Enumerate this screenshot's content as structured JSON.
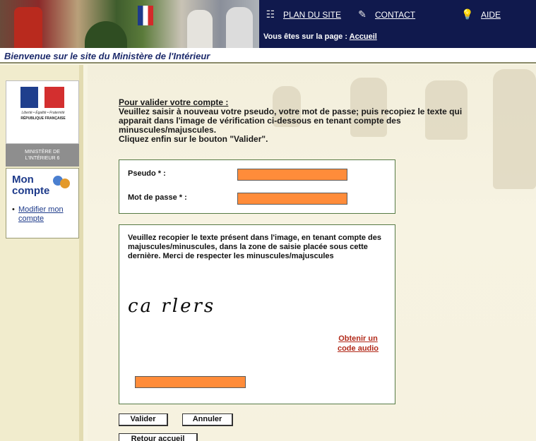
{
  "header": {
    "nav": [
      {
        "label": "PLAN DU SITE",
        "icon": "sitemap-icon"
      },
      {
        "label": "CONTACT",
        "icon": "pencil-icon"
      },
      {
        "label": "AIDE",
        "icon": "lightbulb-icon"
      }
    ],
    "breadcrumb_prefix": "Vous êtes sur la page :",
    "breadcrumb_page": "Accueil",
    "welcome": "Bienvenue sur le site du Ministère de l'Intérieur"
  },
  "sidebar": {
    "ministry_line1": "MINISTÈRE DE",
    "ministry_line2": "L'INTÉRIEUR 6",
    "motto": "Liberté • Égalité • Fraternité",
    "republic": "RÉPUBLIQUE FRANÇAISE",
    "account_title": "Mon compte",
    "account_link": "Modifier mon compte"
  },
  "main": {
    "instructions_head": "Pour valider votre compte :",
    "instructions_line1": "Veuillez saisir à nouveau votre pseudo, votre mot de passe; puis recopiez le texte qui",
    "instructions_line2": "apparait dans l'image de vérification ci-dessous en tenant compte des",
    "instructions_line3": "minuscules/majuscules.",
    "instructions_line4": "Cliquez enfin sur le bouton \"Valider\".",
    "pseudo_label": "Pseudo * :",
    "password_label": "Mot de passe * :",
    "captcha_help": "Veuillez recopier le texte présent dans l'image, en tenant compte des majuscules/minuscules, dans la zone de saisie placée sous cette dernière. Merci de respecter les minuscules/majuscules",
    "captcha_text": "ca rlers",
    "audio_link": "Obtenir un code audio",
    "validate_button": "Valider",
    "cancel_button": "Annuler",
    "home_button": "Retour accueil"
  },
  "colors": {
    "nav_bg": "#10194d",
    "input_fill": "#ff8c3a",
    "box_border": "#567a45",
    "link_red": "#b22a1a",
    "title_blue": "#1c2a6b"
  }
}
